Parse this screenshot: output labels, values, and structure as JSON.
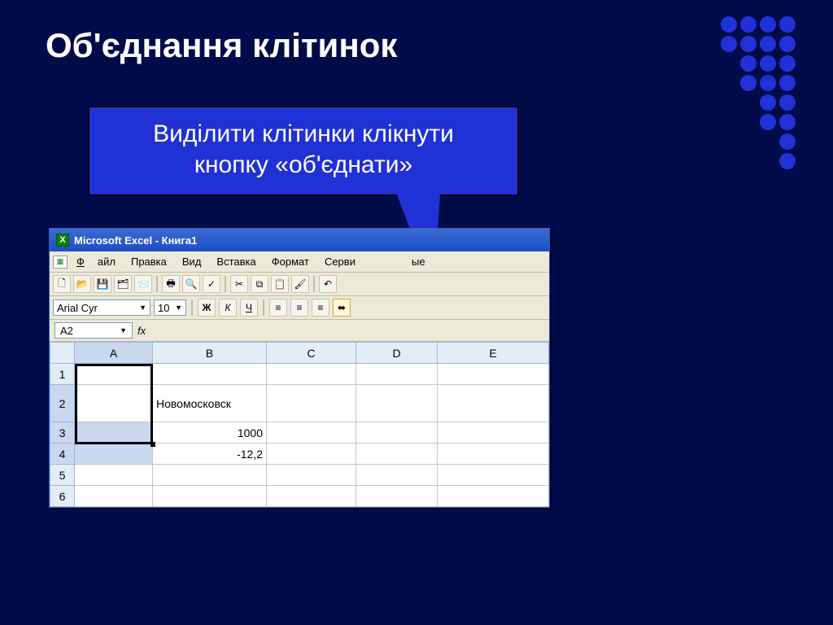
{
  "slide_title": "Об'єднання клітинок",
  "callout": {
    "line1": "Виділити клітинки  клікнути",
    "line2": "кнопку «об'єднати»"
  },
  "excel": {
    "title": "Microsoft Excel - Книга1",
    "menu": {
      "file": "Файл",
      "edit": "Правка",
      "view": "Вид",
      "insert": "Вставка",
      "format": "Формат",
      "tools_prefix": "Серви",
      "data_suffix": "ые"
    },
    "format_bar": {
      "font": "Arial Cyr",
      "size": "10",
      "bold": "Ж",
      "italic": "К",
      "underline": "Ч"
    },
    "name_box": "A2",
    "fx_label": "fx",
    "columns": [
      "A",
      "B",
      "C",
      "D",
      "E"
    ],
    "rows": [
      "1",
      "2",
      "3",
      "4",
      "5",
      "6"
    ],
    "cells": {
      "B2": "Новомосковск",
      "B3": "1000",
      "B4": "-12,2"
    }
  }
}
